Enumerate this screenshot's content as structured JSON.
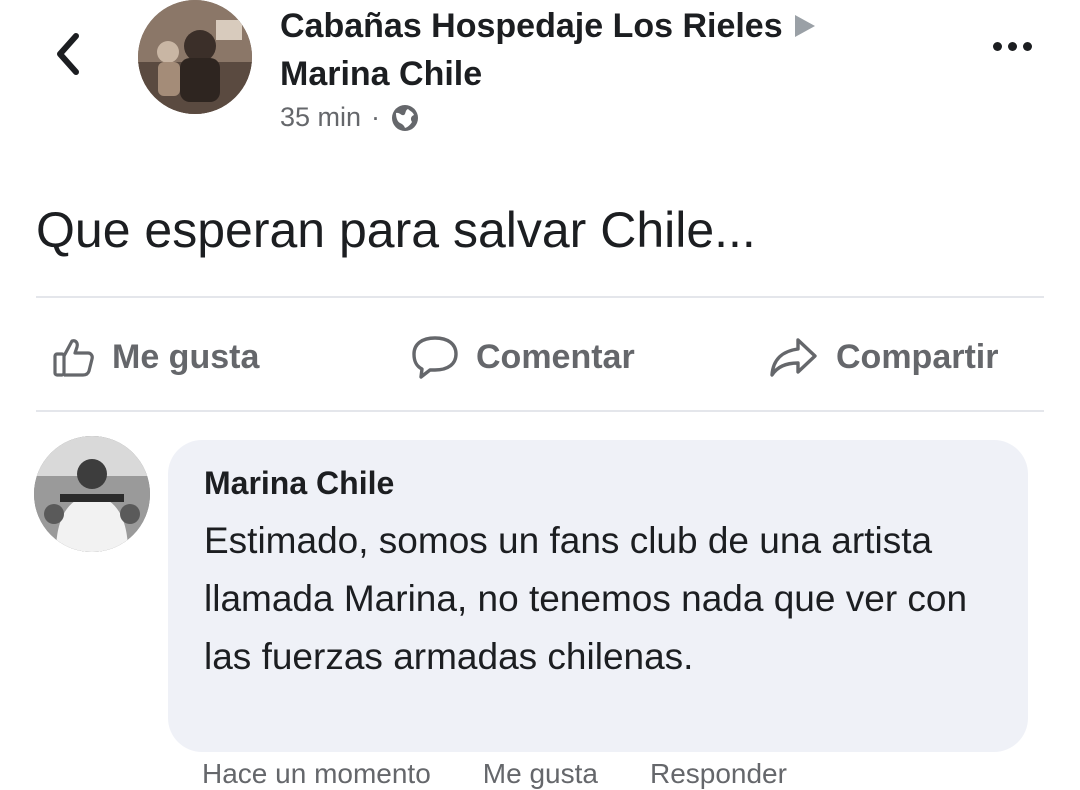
{
  "post": {
    "page_name": "Cabañas Hospedaje Los Rieles",
    "author": "Marina Chile",
    "time": "35 min",
    "separator": "·",
    "privacy_icon": "globe-icon",
    "text": "Que esperan para salvar Chile..."
  },
  "actions": {
    "like": "Me gusta",
    "comment": "Comentar",
    "share": "Compartir"
  },
  "comment": {
    "author": "Marina Chile",
    "text": "Estimado, somos un fans club de una artista llamada Marina, no tenemos nada que ver con las fuerzas armadas chilenas.",
    "time": "Hace un momento",
    "like": "Me gusta",
    "reply": "Responder"
  },
  "colors": {
    "text": "#1c1e21",
    "secondary": "#65676b",
    "bubble": "#eff1f7",
    "divider": "#e4e6eb"
  }
}
